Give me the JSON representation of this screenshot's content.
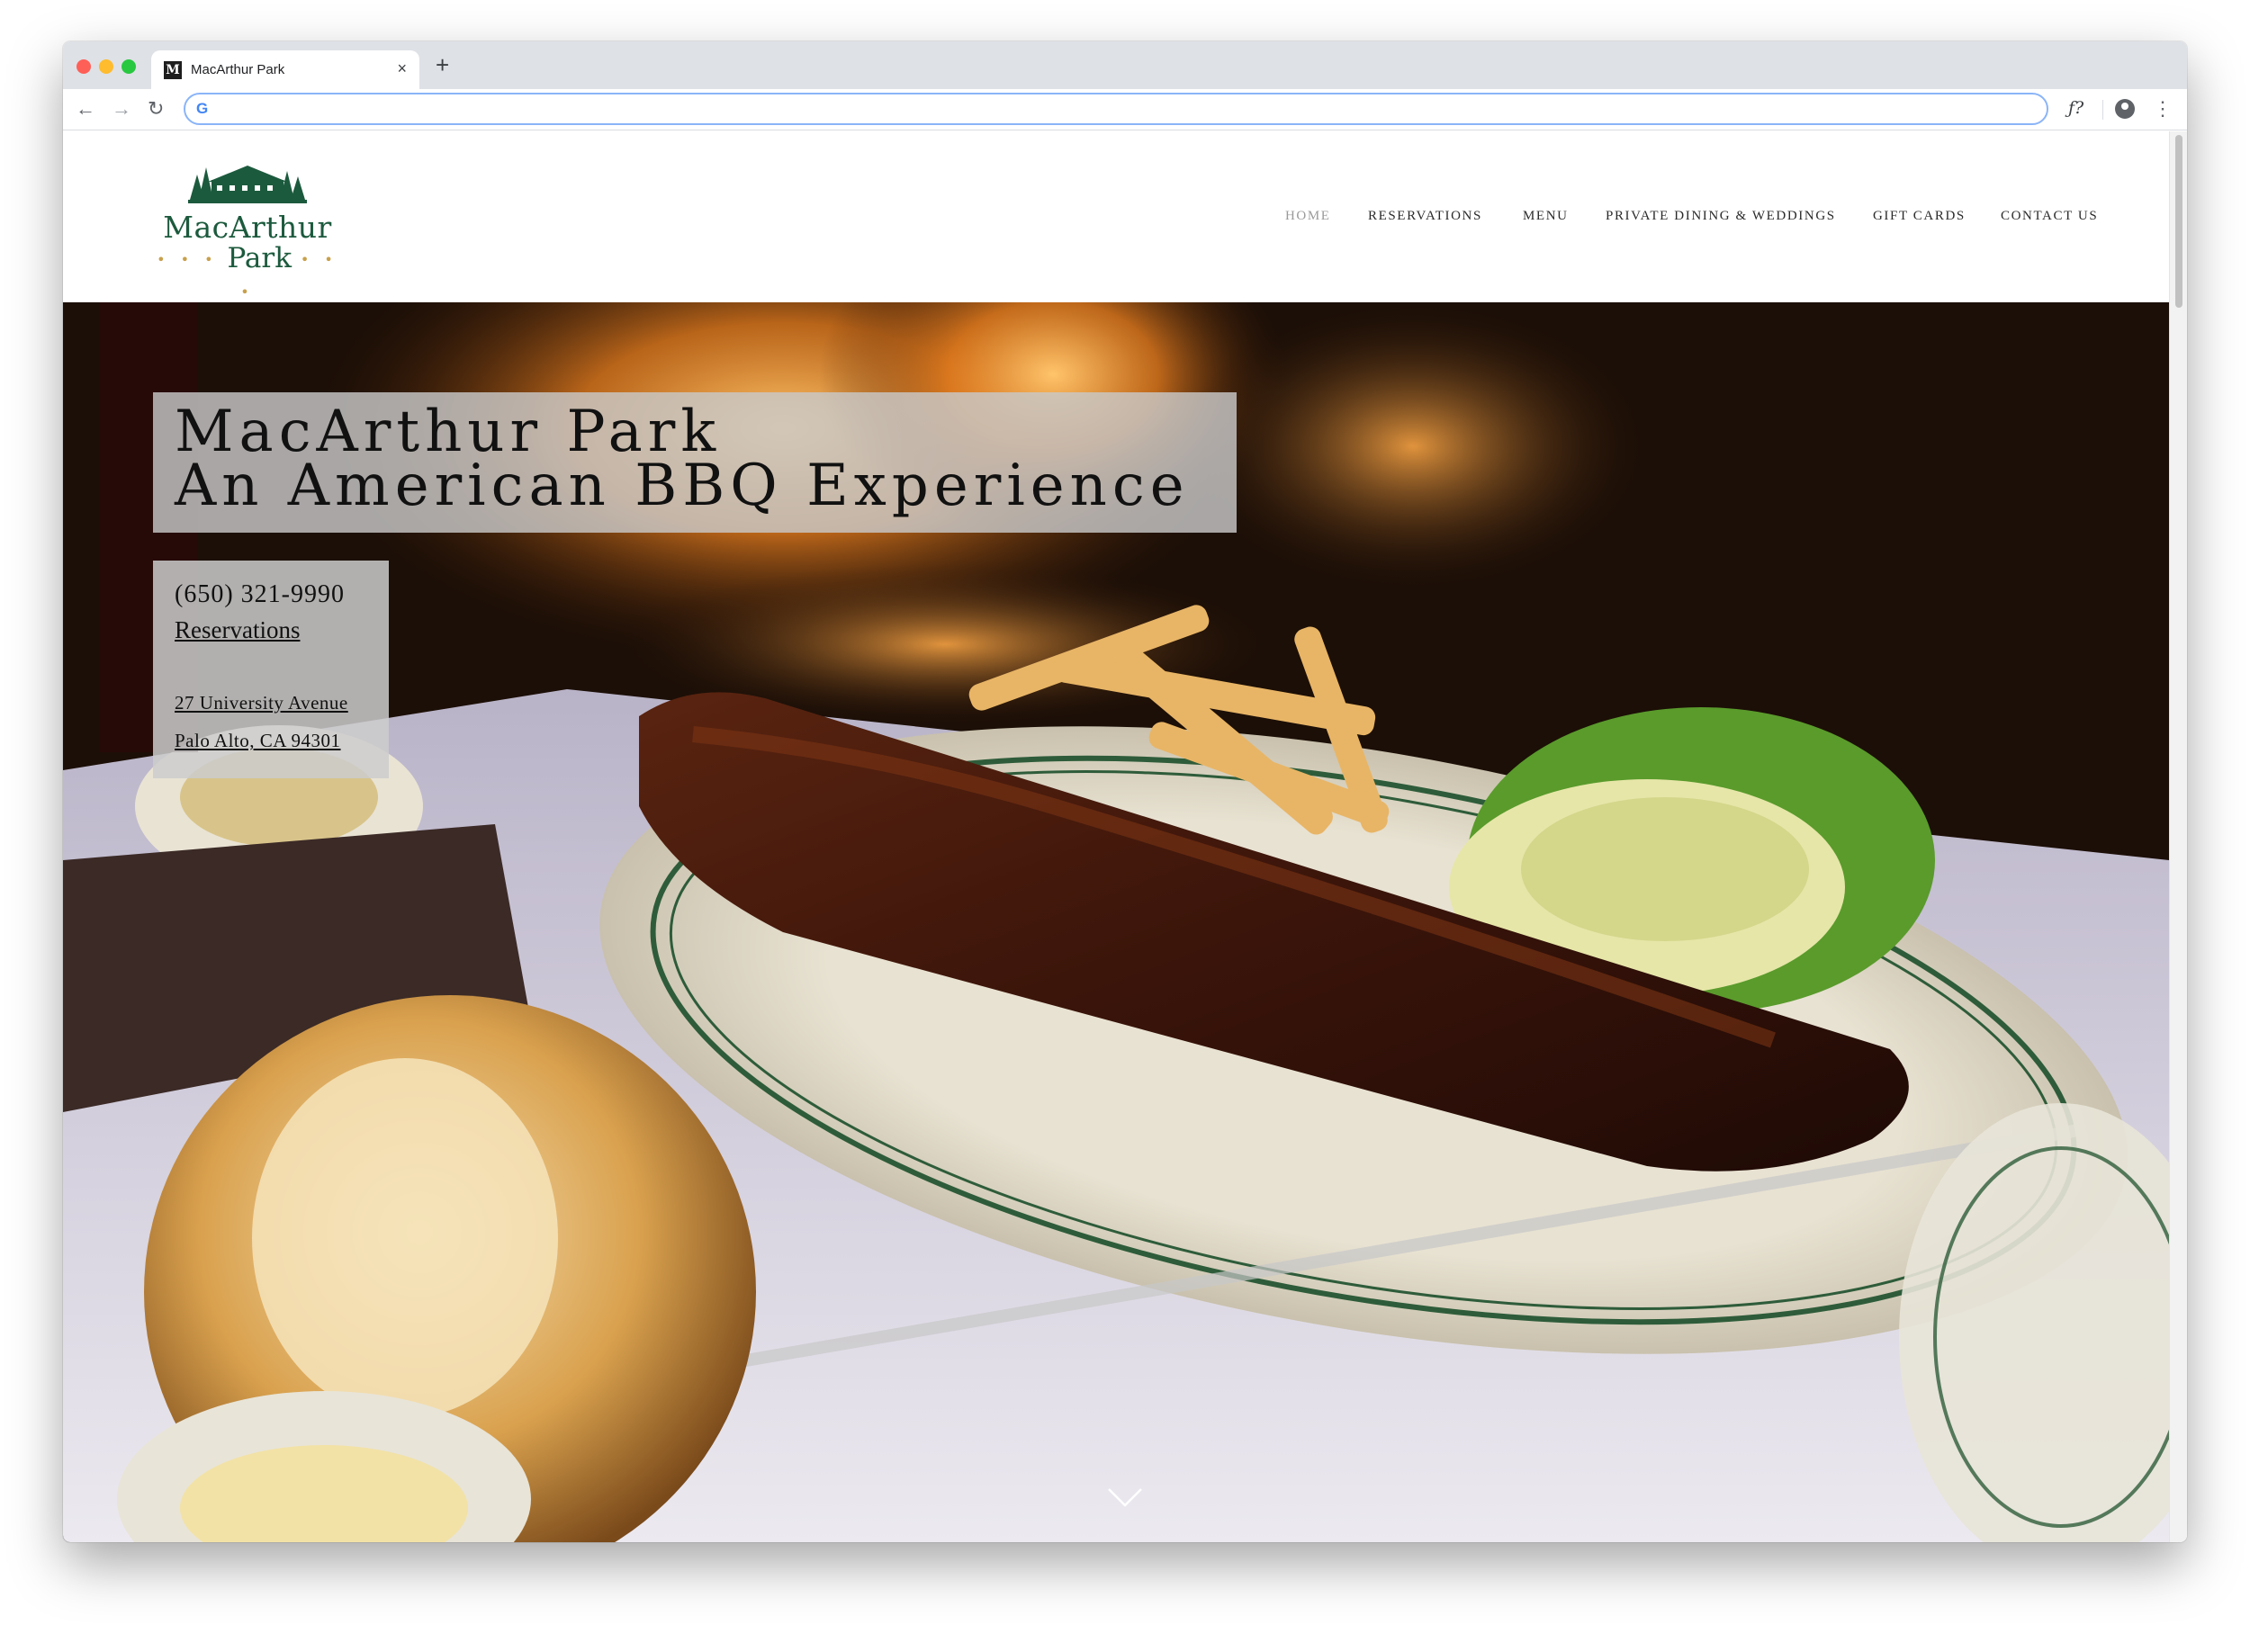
{
  "browser": {
    "tab_title": "MacArthur Park",
    "tab_favicon": "M",
    "tab_close": "×",
    "new_tab": "+",
    "back": "←",
    "forward": "→",
    "reload": "↻",
    "omnibox_icon": "G",
    "omnibox_value": "",
    "extension": "ƒ?",
    "menu": "⋮",
    "icons": [
      "back-arrow-icon",
      "forward-arrow-icon",
      "reload-icon",
      "google-icon",
      "extension-icon",
      "profile-icon",
      "kebab-menu-icon"
    ]
  },
  "site": {
    "logo": {
      "line1": "MacArthur",
      "line2": "Park",
      "dots": "• • •"
    },
    "nav": {
      "home": "HOME",
      "reservations": "RESERVATIONS",
      "menu": "MENU",
      "private_dining": "PRIVATE DINING & WEDDINGS",
      "gift_cards": "GIFT CARDS",
      "contact": "CONTACT US",
      "active": "HOME"
    },
    "hero": {
      "title_line1": "MacArthur Park",
      "title_line2": "An American BBQ Experience",
      "phone": "(650) 321-9990",
      "reservations_link": "Reservations",
      "address_line1": "27 University Avenue",
      "address_line2": "Palo Alto, CA 94301",
      "image": "ribs-fries-coleslaw-plate-photo"
    },
    "colors": {
      "brand_green": "#1c5a3d",
      "brand_gold": "#c8a04c",
      "nav_active": "#9a9a9a"
    }
  }
}
